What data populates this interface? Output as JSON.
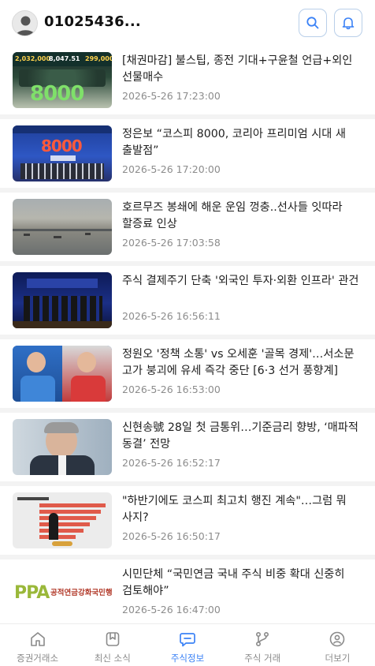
{
  "header": {
    "username": "01025436...",
    "icons": [
      "user-icon",
      "search-icon",
      "bell-icon"
    ]
  },
  "news": [
    {
      "title": "[채권마감] 불스팁, 종전 기대+구윤철 언급+외인 선물매수",
      "date": "2026-5-26 17:23:00"
    },
    {
      "title": "정은보 “코스피 8000, 코리아 프리미엄 시대 새 출발점”",
      "date": "2026-5-26 17:20:00"
    },
    {
      "title": "호르무즈 봉쇄에 해운 운임 껑충..선사들 잇따라 할증료 인상",
      "date": "2026-5-26 17:03:58"
    },
    {
      "title": "주식 결제주기 단축 '외국인 투자·외환 인프라' 관건",
      "date": "2026-5-26 16:56:11"
    },
    {
      "title": "정원오 '정책 소통' vs 오세훈 '골목 경제'…서소문 고가 붕괴에 유세 즉각 중단 [6·3 선거 풍향계]",
      "date": "2026-5-26 16:53:00"
    },
    {
      "title": "신현송號 28일 첫 금통위…기준금리 향방, ‘매파적 동결’ 전망",
      "date": "2026-5-26 16:52:17"
    },
    {
      "title": "\"하반기에도 코스피 최고치 행진 계속\"…그럼 뭐 사지?",
      "date": "2026-5-26 16:50:17"
    },
    {
      "title": "시민단체 “국민연금 국내 주식 비중 확대 신중히 검토해야”",
      "date": "2026-5-26 16:47:00"
    }
  ],
  "thumbs": {
    "t1_nums": [
      "2,032,000",
      "8,047.51",
      "299,000"
    ],
    "t1_big": "8000",
    "t2_big": "8000",
    "t8_logo": "PPA",
    "t8_text": "공적연금강화국민행동"
  },
  "tabs": [
    {
      "label": "증권거래소",
      "icon": "home-icon"
    },
    {
      "label": "최신 소식",
      "icon": "bookmark-icon"
    },
    {
      "label": "주식정보",
      "icon": "chat-icon"
    },
    {
      "label": "주식 거래",
      "icon": "branch-icon"
    },
    {
      "label": "더보기",
      "icon": "profile-icon"
    }
  ],
  "colors": {
    "accent": "#3b82f6",
    "muted": "#8c8c8c",
    "border": "#b9cfe9"
  }
}
